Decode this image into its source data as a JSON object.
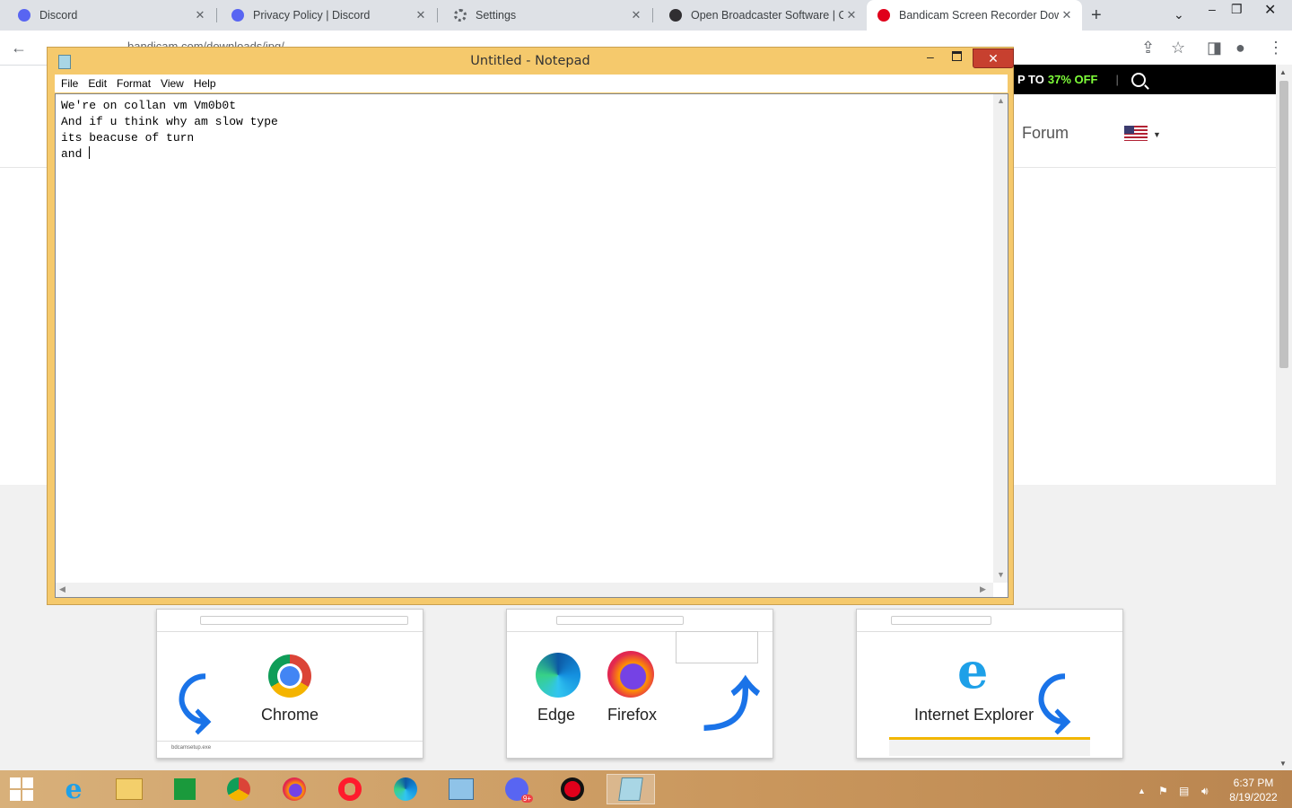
{
  "browser": {
    "tabs": [
      {
        "label": "Discord",
        "color": "#5865f2"
      },
      {
        "label": "Privacy Policy | Discord",
        "color": "#5865f2"
      },
      {
        "label": "Settings",
        "color": "#5f6368"
      },
      {
        "label": "Open Broadcaster Software | OBS",
        "color": "#302e31"
      },
      {
        "label": "Bandicam Screen Recorder Download",
        "color": "#e0001b"
      }
    ],
    "url": "bandicam.com/downloads/ipg/"
  },
  "page": {
    "promo_text": "P TO",
    "promo_highlight": "37% OFF",
    "nav_forum": "Forum",
    "cards": [
      {
        "labels": [
          "Chrome"
        ]
      },
      {
        "labels": [
          "Edge",
          "Firefox"
        ]
      },
      {
        "labels": [
          "Internet Explorer"
        ]
      }
    ],
    "download_file": "bdcamsetup.exe"
  },
  "notepad": {
    "title": "Untitled - Notepad",
    "menu": [
      "File",
      "Edit",
      "Format",
      "View",
      "Help"
    ],
    "text": "We're on collan vm Vm0b0t\nAnd if u think why am slow type\nits beacuse of turn\nand "
  },
  "taskbar": {
    "clock_time": "6:37 PM",
    "clock_date": "8/19/2022",
    "discord_badge": "9+"
  }
}
